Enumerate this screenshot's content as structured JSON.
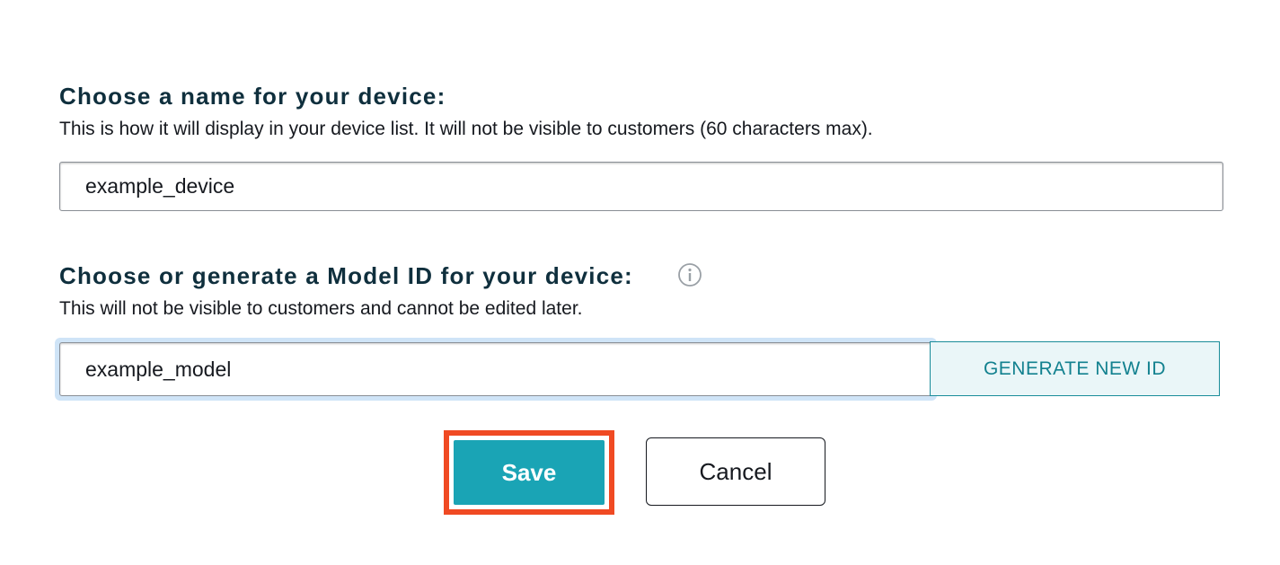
{
  "device_name": {
    "title": "Choose a name for your device:",
    "description": "This is how it will display in your device list. It will not be visible to customers (60 characters max).",
    "value": "example_device"
  },
  "model_id": {
    "title": "Choose or generate a Model ID for your device:",
    "info_icon": "info-circle-icon",
    "description": "This will not be visible to customers and cannot be edited later.",
    "value": "example_model",
    "generate_label": "GENERATE NEW ID"
  },
  "actions": {
    "save_label": "Save",
    "cancel_label": "Cancel"
  },
  "colors": {
    "heading": "#0f2f3d",
    "accent": "#1aa4b5",
    "highlight": "#f04a23",
    "focus_ring": "#cfe4f7"
  }
}
